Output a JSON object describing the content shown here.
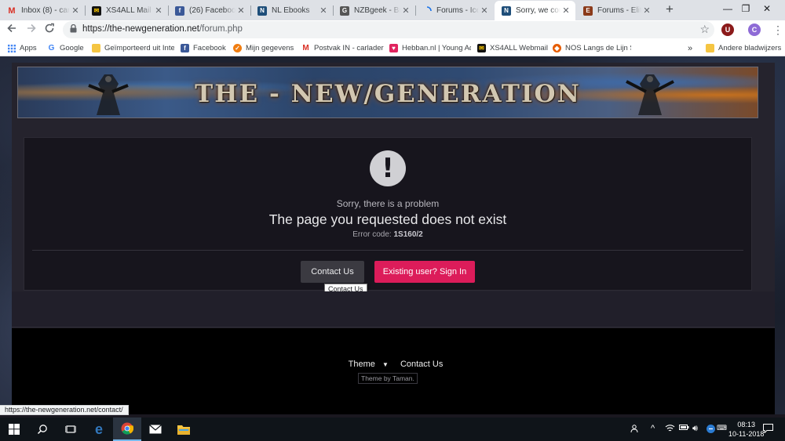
{
  "tabs": [
    {
      "title": "Inbox (8) - carl",
      "icon": "gmail-icon",
      "color": "#d93025"
    },
    {
      "title": "XS4ALL Mail ::",
      "icon": "xs4all-icon",
      "color": "#111111"
    },
    {
      "title": "(26) Facebook",
      "icon": "facebook-icon",
      "color": "#3b5998"
    },
    {
      "title": "NL Ebooks",
      "icon": "nl-ebooks-icon",
      "color": "#1e4e79"
    },
    {
      "title": "NZBgeek - Bro",
      "icon": "nzbgeek-icon",
      "color": "#555555"
    },
    {
      "title": "Forums - Icew",
      "icon": "loading-icon",
      "color": "#1a73e8"
    },
    {
      "title": "Sorry, we coul",
      "icon": "tng-icon",
      "color": "#1e4e79"
    },
    {
      "title": "Forums - Elite",
      "icon": "elite-icon",
      "color": "#8b3a1a"
    }
  ],
  "window": {
    "new_tab": "+",
    "minimize": "—",
    "maximize": "❐",
    "close": "✕"
  },
  "address_bar": {
    "host": "https://the-newgeneration.net",
    "path": "/forum.php"
  },
  "profile": {
    "ext_letter": "U",
    "avatar_letter": "C"
  },
  "bookmarks": [
    {
      "label": "Apps",
      "icon": "apps-icon",
      "color": "#4285f4"
    },
    {
      "label": "Google",
      "icon": "google-icon",
      "color": "#4285f4"
    },
    {
      "label": "Geïmporteerd uit Inte",
      "icon": "folder-icon",
      "color": "#f5c542"
    },
    {
      "label": "Facebook",
      "icon": "facebook-icon",
      "color": "#3b5998"
    },
    {
      "label": "Mijn gegevens",
      "icon": "mijn-gegevens-icon",
      "color": "#f07d10"
    },
    {
      "label": "Postvak IN - carlader",
      "icon": "gmail-icon",
      "color": "#d93025"
    },
    {
      "label": "Hebban.nl | Young Ad",
      "icon": "hebban-icon",
      "color": "#e0245e"
    },
    {
      "label": "XS4ALL Webmail",
      "icon": "xs4all-icon",
      "color": "#111111"
    },
    {
      "label": "NOS Langs de Lijn Sp",
      "icon": "nos-icon",
      "color": "#e65c00"
    },
    {
      "label": "»",
      "icon": "",
      "color": ""
    },
    {
      "label": "Andere bladwijzers",
      "icon": "folder-icon",
      "color": "#f5c542"
    }
  ],
  "banner": {
    "title": "THE - NEW/GENERATION"
  },
  "error": {
    "subtitle": "Sorry, there is a problem",
    "title": "The page you requested does not exist",
    "code_label": "Error code: ",
    "code_value": "1S160/2",
    "icon": "!"
  },
  "buttons": {
    "contact": "Contact Us",
    "signin": "Existing user? Sign In"
  },
  "tooltip": "Contact Us",
  "footer": {
    "theme": "Theme",
    "contact": "Contact Us",
    "credit": "Theme by Taman."
  },
  "status_url": "https://the-newgeneration.net/contact/",
  "clock": {
    "time": "08:13",
    "date": "10-11-2018"
  }
}
